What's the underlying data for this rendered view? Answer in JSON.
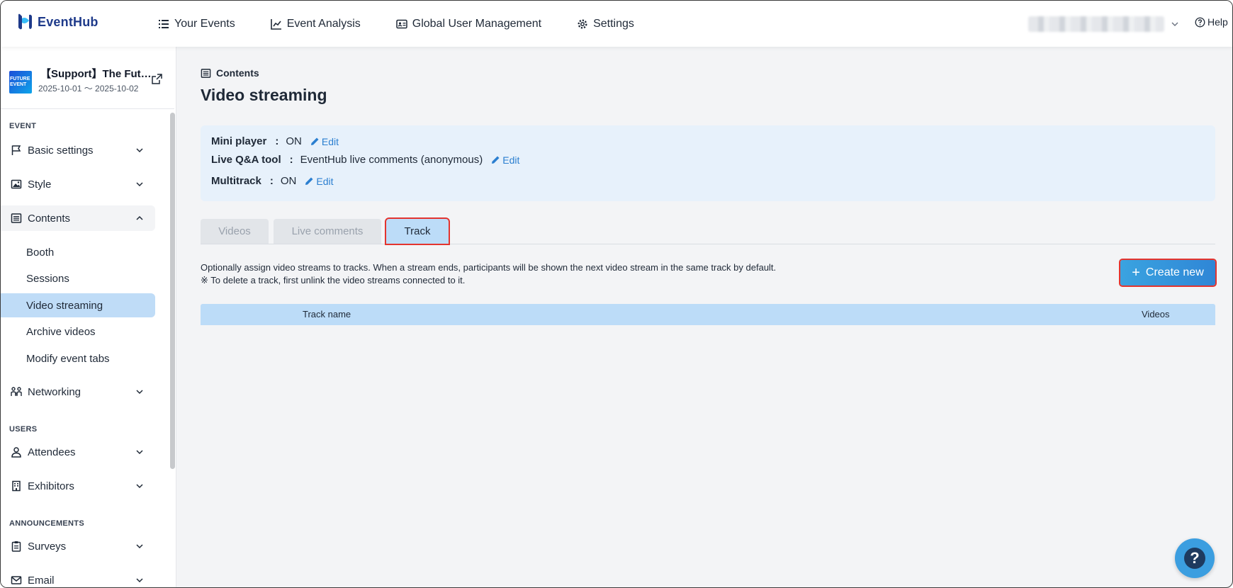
{
  "app": {
    "name": "EventHub"
  },
  "nav": {
    "items": [
      {
        "label": "Your Events",
        "icon": "list-icon"
      },
      {
        "label": "Event Analysis",
        "icon": "chart-line-icon"
      },
      {
        "label": "Global User Management",
        "icon": "id-card-icon"
      },
      {
        "label": "Settings",
        "icon": "gear-icon"
      }
    ],
    "help_label": "Help"
  },
  "event": {
    "thumb_text": "FUTURE EVENT",
    "title": "【Support】The Future Event",
    "dates": "2025-10-01 〜 2025-10-02"
  },
  "sidebar": {
    "sections": {
      "event": "EVENT",
      "users": "USERS",
      "announcements": "ANNOUNCEMENTS"
    },
    "items": {
      "basic_settings": "Basic settings",
      "style": "Style",
      "contents": "Contents",
      "networking": "Networking",
      "attendees": "Attendees",
      "exhibitors": "Exhibitors",
      "surveys": "Surveys",
      "email": "Email"
    },
    "sub_items": {
      "booth": "Booth",
      "sessions": "Sessions",
      "video_streaming": "Video streaming",
      "archive_videos": "Archive videos",
      "modify_event_tabs": "Modify event tabs"
    }
  },
  "main": {
    "breadcrumb": "Contents",
    "title": "Video streaming",
    "settings": [
      {
        "label": "Mini player",
        "value": "ON",
        "edit": "Edit"
      },
      {
        "label": "Live Q&A tool",
        "value": "EventHub live comments (anonymous)",
        "edit": "Edit"
      },
      {
        "label": "Multitrack",
        "value": "ON",
        "edit": "Edit"
      }
    ],
    "colon": ":",
    "tabs": [
      {
        "label": "Videos",
        "active": false
      },
      {
        "label": "Live comments",
        "active": false
      },
      {
        "label": "Track",
        "active": true
      }
    ],
    "description_line1": "Optionally assign video streams to tracks. When a stream ends, participants will be shown the next video stream in the same track by default.",
    "description_line2": "※ To delete a track, first unlink the video streams connected to it.",
    "create_button": {
      "icon": "+",
      "label": "Create new"
    },
    "table": {
      "columns": [
        "Track name",
        "Videos"
      ],
      "rows": []
    }
  },
  "support_fab": {
    "icon": "?"
  },
  "colors": {
    "accent": "#2f86d6",
    "active_tab": "#bcdcf8",
    "highlight_outline": "#e3342f",
    "settings_box": "#e7f1fb"
  }
}
